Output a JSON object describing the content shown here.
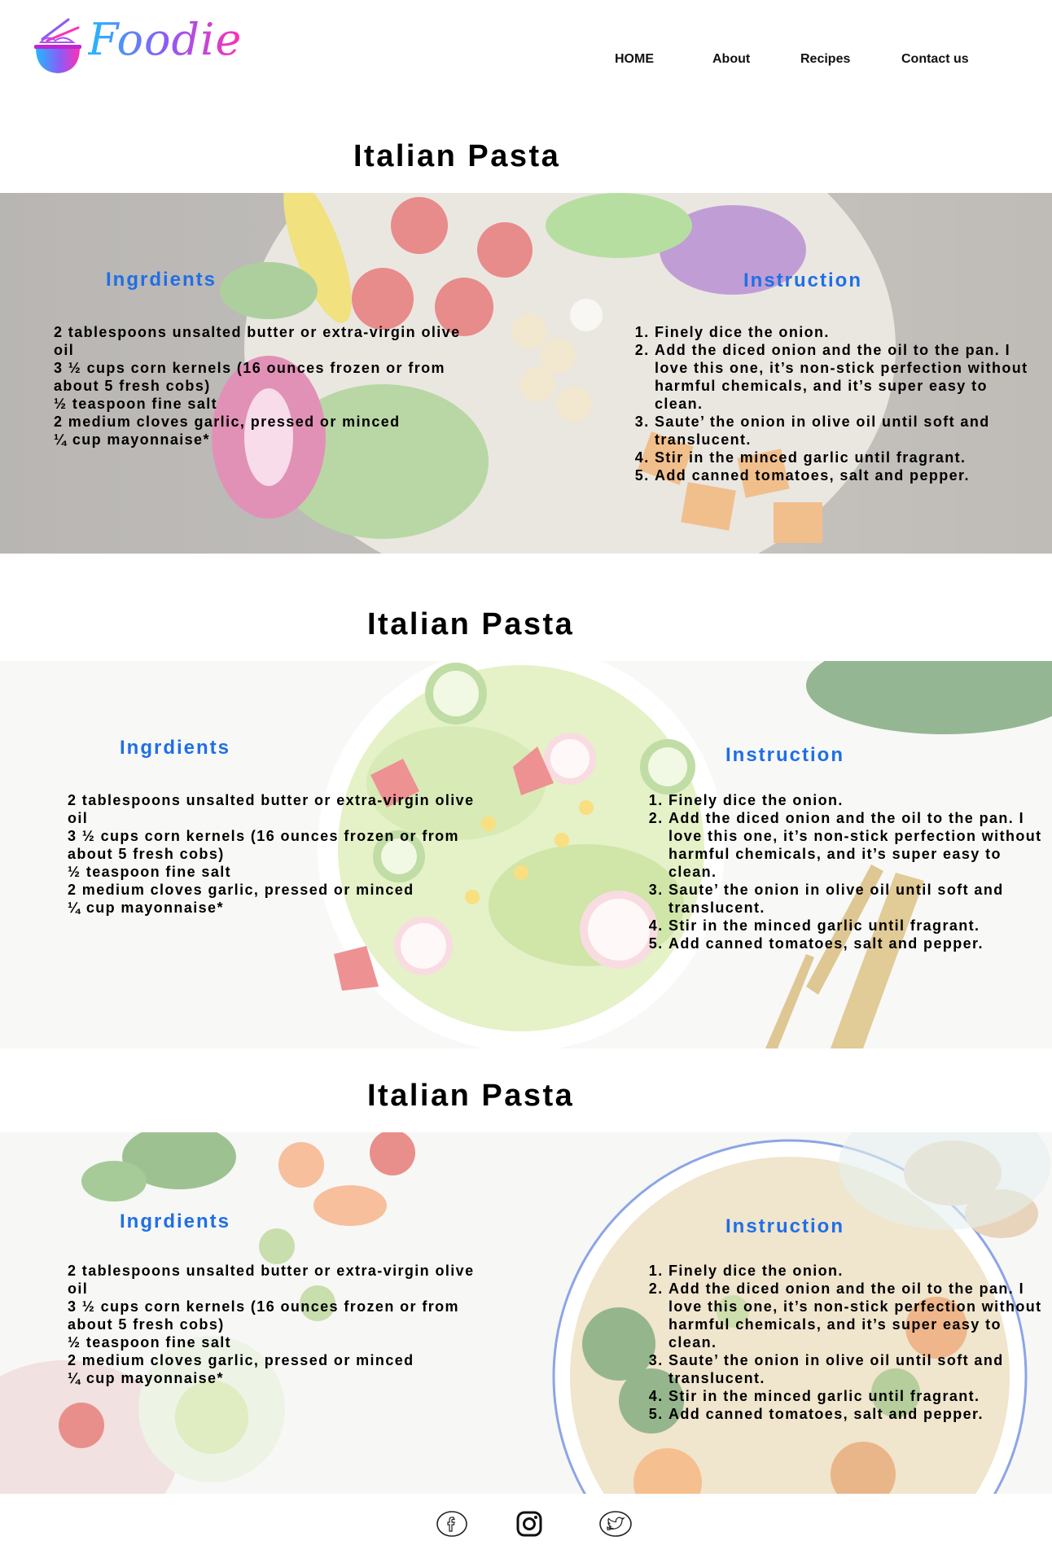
{
  "header": {
    "logo_text": "Foodie",
    "nav": [
      "HOME",
      "About",
      "Recipes",
      "Contact us"
    ]
  },
  "sections": [
    {
      "title": "Italian Pasta",
      "ingredients_heading": "Ingrdients",
      "instruction_heading": "Instruction",
      "ingredients": [
        "2 tablespoons unsalted butter or extra-virgin olive oil",
        "3 ½ cups corn kernels (16 ounces frozen or from about 5 fresh cobs)",
        "½ teaspoon fine salt",
        "2 medium cloves garlic, pressed or minced",
        "¼ cup mayonnaise*"
      ],
      "instructions": [
        "Finely dice the onion.",
        "Add the diced onion and the oil to the pan. I love this one, it’s non-stick perfection without harmful chemicals, and it’s super easy to clean.",
        "Saute’ the onion in olive oil until soft and translucent.",
        "Stir in the minced garlic until fragrant.",
        "Add canned tomatoes, salt and pepper."
      ]
    },
    {
      "title": "Italian Pasta",
      "ingredients_heading": "Ingrdients",
      "instruction_heading": "Instruction",
      "ingredients": [
        "2 tablespoons unsalted butter or extra-virgin olive oil",
        "3 ½ cups corn kernels (16 ounces frozen or from about 5 fresh cobs)",
        "½ teaspoon fine salt",
        "2 medium cloves garlic, pressed or minced",
        "¼ cup mayonnaise*"
      ],
      "instructions": [
        "Finely dice the onion.",
        "Add the diced onion and the oil to the pan. I love this one, it’s non-stick perfection without harmful chemicals, and it’s super easy to clean.",
        "Saute’ the onion in olive oil until soft and translucent.",
        "Stir in the minced garlic until fragrant.",
        "Add canned tomatoes, salt and pepper."
      ]
    },
    {
      "title": "Italian Pasta",
      "ingredients_heading": "Ingrdients",
      "instruction_heading": "Instruction",
      "ingredients": [
        "2 tablespoons unsalted butter or extra-virgin olive oil",
        "3 ½ cups corn kernels (16 ounces frozen or from about 5 fresh cobs)",
        "½ teaspoon fine salt",
        "2 medium cloves garlic, pressed or minced",
        "¼ cup mayonnaise*"
      ],
      "instructions": [
        "Finely dice the onion.",
        "Add the diced onion and the oil to the pan. I love this one, it’s non-stick perfection without harmful chemicals, and it’s super easy to clean.",
        "Saute’ the onion in olive oil until soft and translucent.",
        "Stir in the minced garlic until fragrant.",
        "Add canned tomatoes, salt and pepper."
      ]
    }
  ],
  "footer": {
    "social_icons": [
      "facebook-icon",
      "instagram-icon",
      "twitter-icon"
    ]
  },
  "colors": {
    "heading_blue": "#1f6fe5",
    "logo_gradient": [
      "#22b8ff",
      "#8b5cf6",
      "#ff2fb3"
    ]
  }
}
